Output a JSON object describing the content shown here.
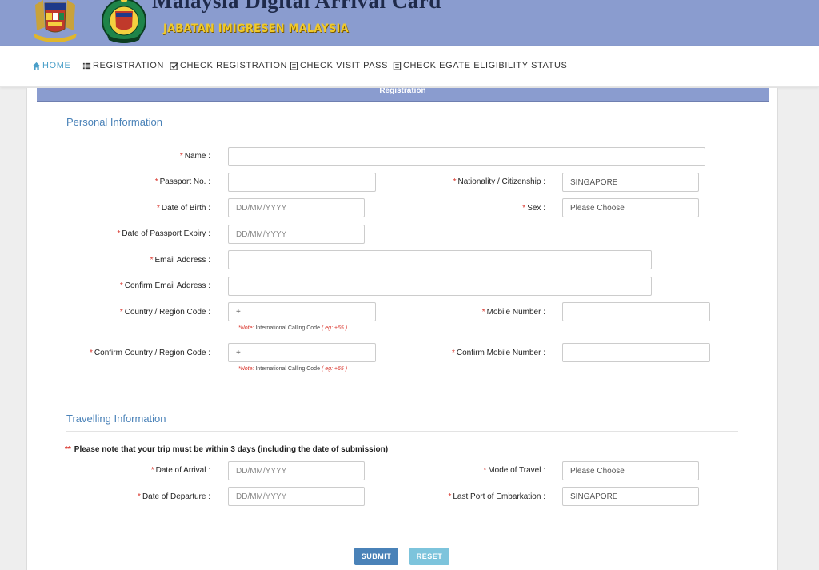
{
  "header": {
    "title": "Malaysia Digital Arrival Card",
    "department": "JABATAN IMIGRESEN MALAYSIA"
  },
  "nav": {
    "home": "HOME",
    "registration": "REGISTRATION",
    "check_registration": "CHECK REGISTRATION",
    "check_visit_pass": "CHECK VISIT PASS",
    "check_egate": "CHECK EGATE ELIGIBILITY STATUS"
  },
  "panel": {
    "heading": "Registration"
  },
  "personal": {
    "section_title": "Personal Information",
    "name_label": "Name :",
    "passport_label": "Passport No. :",
    "nationality_label": "Nationality / Citizenship :",
    "nationality_value": "SINGAPORE",
    "dob_label": "Date of Birth :",
    "dob_placeholder": "DD/MM/YYYY",
    "sex_label": "Sex :",
    "sex_value": "Please Choose",
    "passport_expiry_label": "Date of Passport Expiry :",
    "passport_expiry_placeholder": "DD/MM/YYYY",
    "email_label": "Email Address :",
    "confirm_email_label": "Confirm Email Address :",
    "country_code_label": "Country / Region Code :",
    "country_code_value": "+",
    "mobile_label": "Mobile Number :",
    "confirm_country_code_label": "Confirm Country / Region Code :",
    "confirm_country_code_value": "+",
    "confirm_mobile_label": "Confirm Mobile Number :",
    "note_prefix": "*Note:",
    "note_text": "International Calling Code",
    "note_example": "( eg: +65 )"
  },
  "travel": {
    "section_title": "Travelling Information",
    "notice_marker": "**",
    "notice": "Please note that your trip must be within 3 days (including the date of submission)",
    "arrival_label": "Date of Arrival :",
    "arrival_placeholder": "DD/MM/YYYY",
    "mode_label": "Mode of Travel :",
    "mode_value": "Please Choose",
    "departure_label": "Date of Departure :",
    "departure_placeholder": "DD/MM/YYYY",
    "last_port_label": "Last Port of Embarkation :",
    "last_port_value": "SINGAPORE"
  },
  "required_marker": "*",
  "buttons": {
    "submit": "SUBMIT",
    "reset": "RESET"
  },
  "colors": {
    "header_bg": "#8a9ccf",
    "accent": "#4a82b8",
    "nav_active": "#4a9fc9",
    "required": "#d9342b",
    "reset_button": "#7dc4dc",
    "department_text": "#f0c92a"
  }
}
